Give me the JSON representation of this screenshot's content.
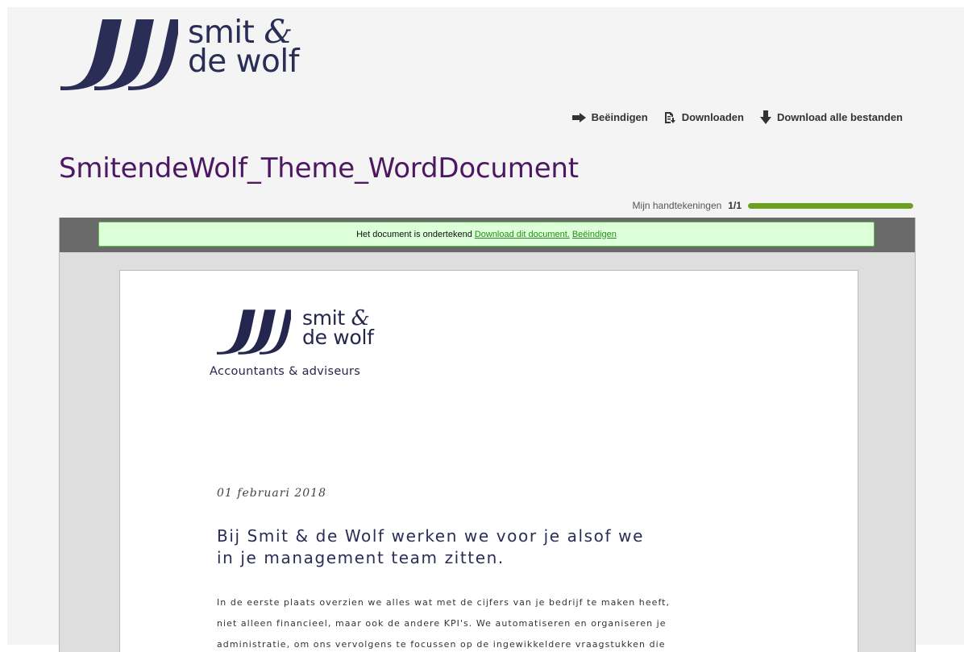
{
  "brand": {
    "name_line1": "smit",
    "amp": "&",
    "name_line2": "de wolf",
    "tagline": "Accountants & adviseurs",
    "color": "#2a2d55"
  },
  "toolbar": {
    "finish_label": "Beëindigen",
    "download_label": "Downloaden",
    "download_all_label": "Download alle bestanden"
  },
  "document_title": "SmitendeWolf_Theme_WordDocument",
  "signatures": {
    "label": "Mijn handtekeningen",
    "done": "1",
    "total": "/1",
    "progress_fraction": 1.0,
    "progress_color": "#6aa121"
  },
  "notice": {
    "text": "Het document is ondertekend",
    "download_link": "Download dit document.",
    "finish_link": "Beëindigen"
  },
  "document": {
    "date": "01 februari 2018",
    "heading_line1": "Bij Smit & de Wolf werken we voor je alsof we",
    "heading_line2": "in je management team zitten.",
    "body_lines": [
      "In de eerste plaats overzien we alles wat met de cijfers van je bedrijf te maken heeft,",
      "niet alleen financieel, maar ook de andere KPI's. We automatiseren en organiseren je",
      "administratie, om ons vervolgens te focussen op de ingewikkeldere vraagstukken die"
    ]
  },
  "colors": {
    "title": "#4d1862",
    "notice_bg": "#dcffd9",
    "notice_border": "#5fbb4c",
    "viewer_bar": "#6a6a6a"
  }
}
